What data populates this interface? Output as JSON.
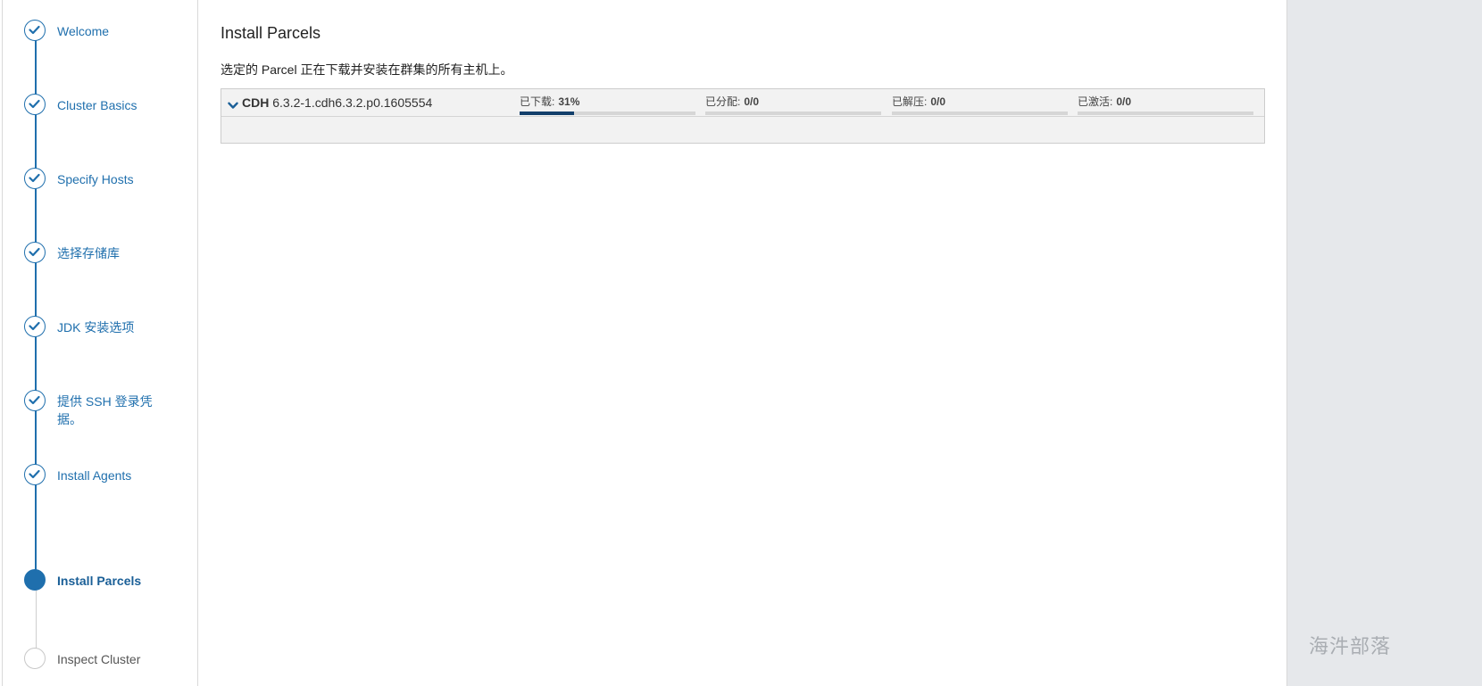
{
  "sidebar": {
    "steps": [
      {
        "label": "Welcome",
        "state": "done"
      },
      {
        "label": "Cluster Basics",
        "state": "done"
      },
      {
        "label": "Specify Hosts",
        "state": "done"
      },
      {
        "label": "选择存储库",
        "state": "done"
      },
      {
        "label": "JDK 安装选项",
        "state": "done"
      },
      {
        "label": "提供 SSH 登录凭据。",
        "state": "done"
      },
      {
        "label": "Install Agents",
        "state": "done"
      },
      {
        "label": "Install Parcels",
        "state": "current"
      },
      {
        "label": "Inspect Cluster",
        "state": "todo"
      }
    ]
  },
  "main": {
    "title": "Install Parcels",
    "description": "选定的 Parcel 正在下载并安装在群集的所有主机上。",
    "parcel": {
      "product": "CDH",
      "version": "6.3.2-1.cdh6.3.2.p0.1605554",
      "progress": [
        {
          "label": "已下载:",
          "value": "31%",
          "fraction": 0.31
        },
        {
          "label": "已分配:",
          "value": "0/0",
          "fraction": 0
        },
        {
          "label": "已解压:",
          "value": "0/0",
          "fraction": 0
        },
        {
          "label": "已激活:",
          "value": "0/0",
          "fraction": 0
        }
      ]
    }
  },
  "watermark": "海汼部落",
  "colors": {
    "accent": "#1f6fad",
    "progress_fill": "#133f6b",
    "side_panel": "#e6e8eb"
  }
}
